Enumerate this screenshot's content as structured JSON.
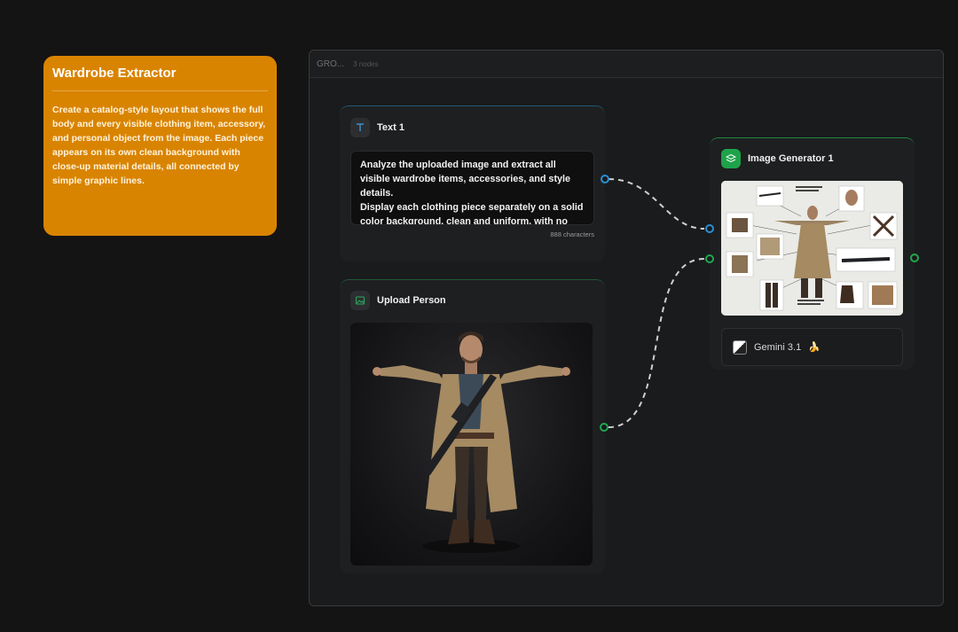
{
  "note": {
    "title": "Wardrobe Extractor",
    "body": "Create a catalog-style layout that shows the full body and every visible clothing item, accessory, and personal object from the image. Each piece appears on its own clean background with close-up material details, all connected by simple graphic lines."
  },
  "group": {
    "title": "GRO...",
    "subtitle": "3 nodes"
  },
  "text_node": {
    "title": "Text 1",
    "icon": "text-icon",
    "content": "Analyze the uploaded image and extract all visible wardrobe items, accessories, and style details.\nDisplay each clothing piece separately on a solid color background, clean and uniform, with no",
    "char_count": "888 characters"
  },
  "upload_node": {
    "title": "Upload Person",
    "icon": "image-icon"
  },
  "generator_node": {
    "title": "Image Generator 1",
    "icon": "layers-icon",
    "model": "Gemini 3.1",
    "model_emoji": "🍌"
  },
  "colors": {
    "note_bg": "#d98400",
    "text_port": "#2a8fd4",
    "image_port": "#1fa84f",
    "canvas_bg": "#141414"
  }
}
